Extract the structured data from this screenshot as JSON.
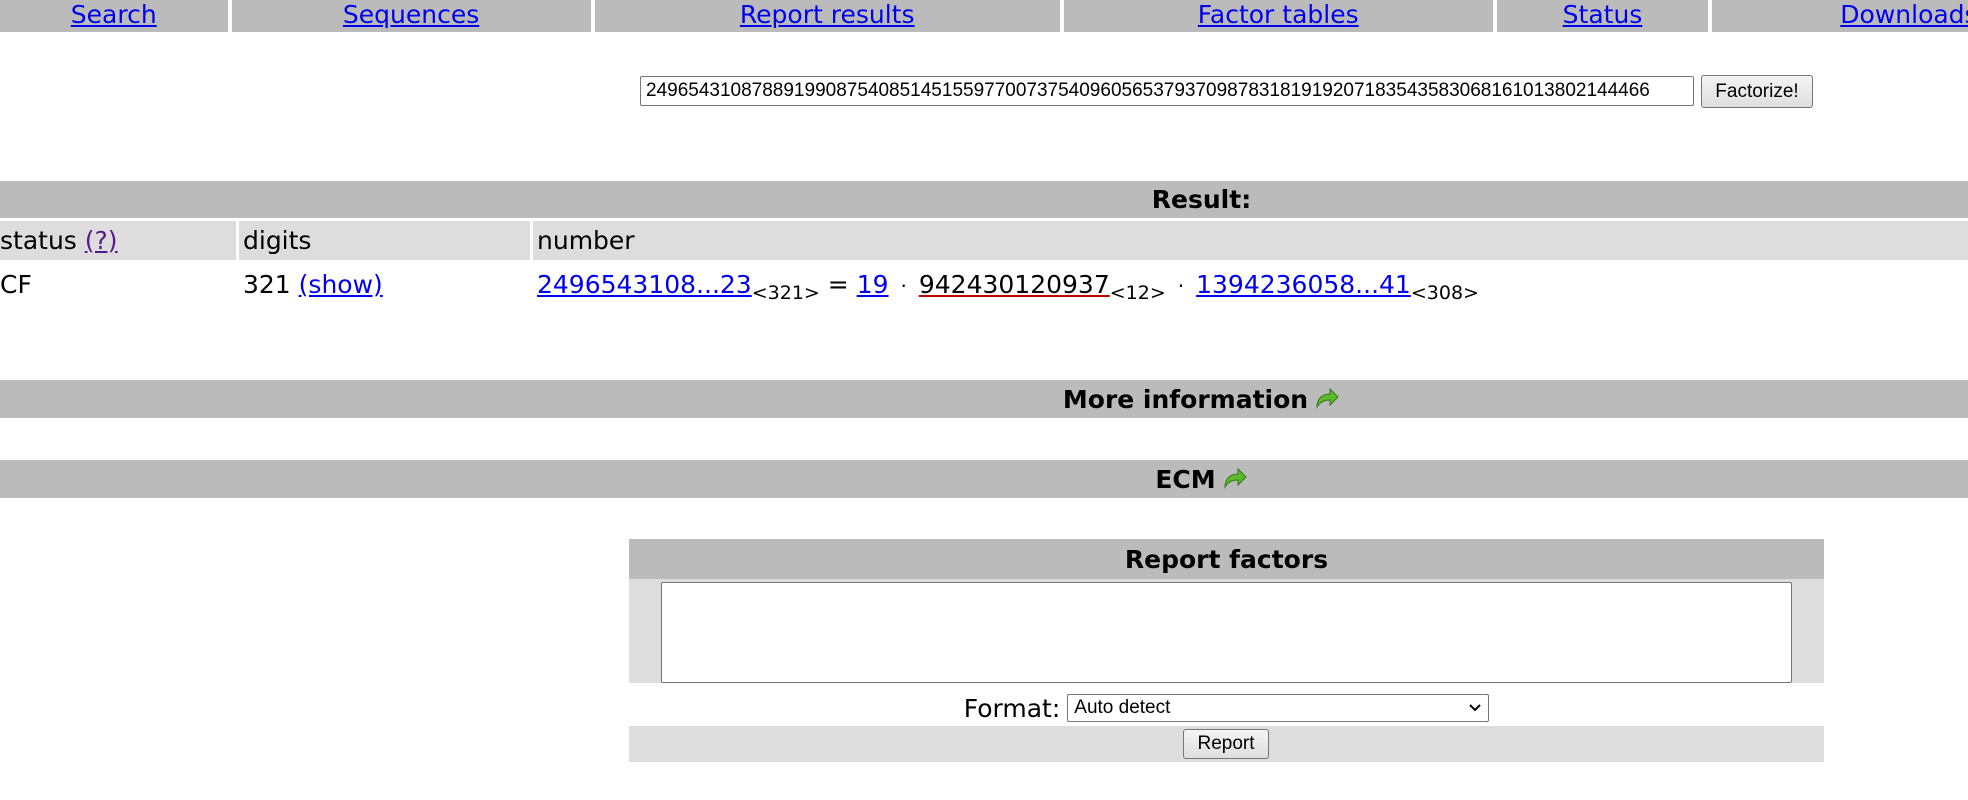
{
  "nav": {
    "items": [
      {
        "label": "Search"
      },
      {
        "label": "Sequences"
      },
      {
        "label": "Report results"
      },
      {
        "label": "Factor tables"
      },
      {
        "label": "Status"
      },
      {
        "label": "Downloads"
      }
    ]
  },
  "factorize": {
    "query": "24965431087889199087540851451559770073754096056537937098783181919207183543583068161013802144466",
    "button_label": "Factorize!"
  },
  "result": {
    "title": "Result:",
    "headers": {
      "status": "status",
      "status_help": "(?)",
      "digits": "digits",
      "number": "number"
    },
    "row": {
      "status": "CF",
      "digits": "321",
      "show_link": "(show)",
      "number_abbrev": "2496543108...23",
      "number_digits": "<321>",
      "equals": "=",
      "factor1": "19",
      "dot1": "·",
      "factor2": "942430120937",
      "factor2_digits": "<12>",
      "dot2": "·",
      "factor3": "1394236058...41",
      "factor3_digits": "<308>"
    }
  },
  "more_info": {
    "title": "More information",
    "icon": "green-arrow-icon"
  },
  "ecm": {
    "title": "ECM",
    "icon": "green-arrow-icon"
  },
  "report": {
    "title": "Report factors",
    "textarea_value": "",
    "format_label": "Format:",
    "format_selected": "Auto detect",
    "button_label": "Report"
  },
  "colors": {
    "bar_dark": "#bbbbbb",
    "bar_light": "#dddddd",
    "link": "#0000ee",
    "arrow_green": "#5cb82c"
  }
}
